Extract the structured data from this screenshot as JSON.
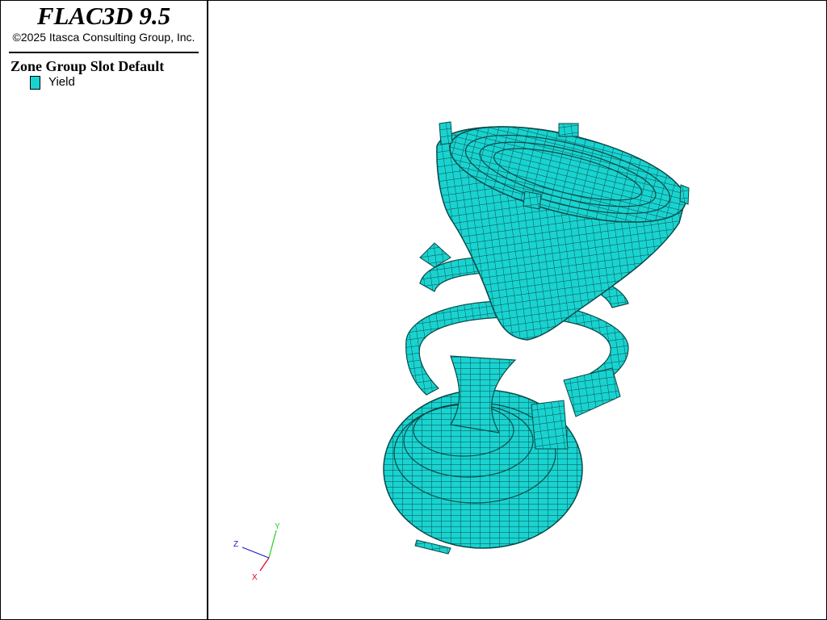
{
  "app": {
    "title": "FLAC3D 9.5",
    "copyright": "©2025 Itasca Consulting Group, Inc."
  },
  "legend": {
    "heading": "Zone Group Slot Default",
    "items": [
      {
        "label": "Yield",
        "color": "#19d3d0"
      }
    ]
  },
  "model": {
    "fill_color": "#19d3d0",
    "mesh_color": "#0a4a48"
  },
  "axes": {
    "x": {
      "label": "X",
      "color": "#e0001a"
    },
    "y": {
      "label": "Y",
      "color": "#22cc22"
    },
    "z": {
      "label": "Z",
      "color": "#1a1acc"
    }
  }
}
